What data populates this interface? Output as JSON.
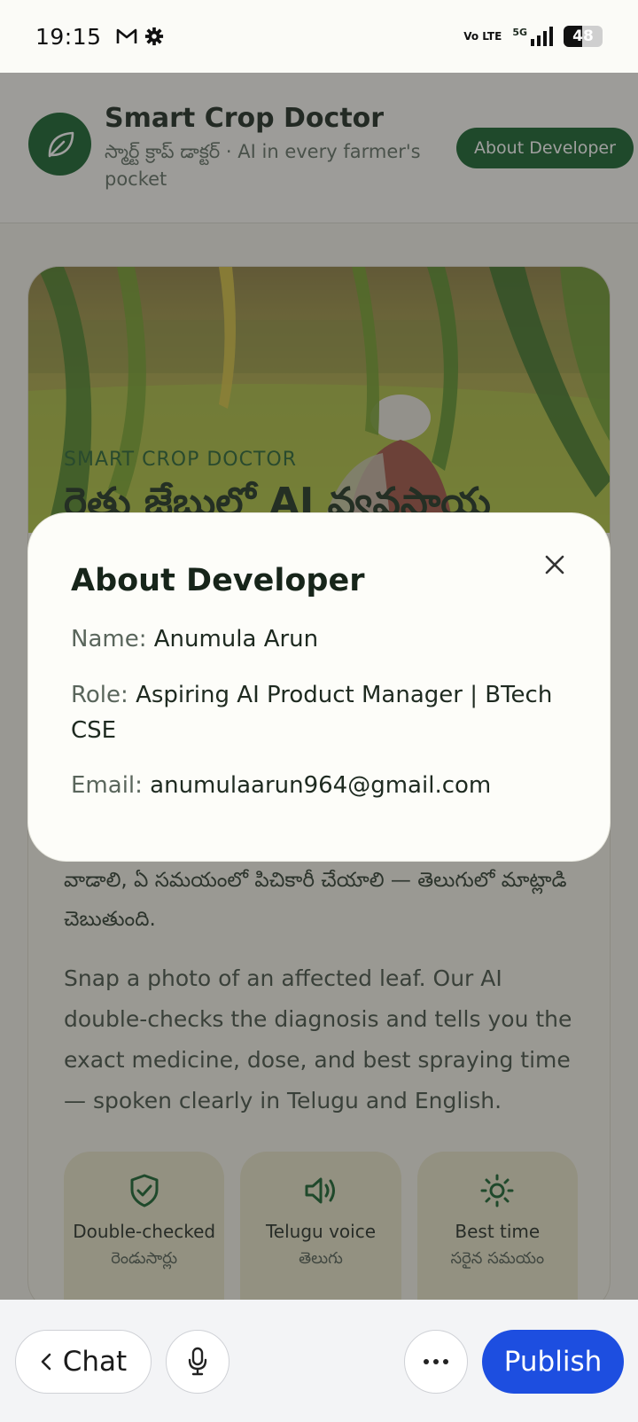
{
  "status_bar": {
    "time": "19:15",
    "icons": [
      "gmail-icon",
      "settings-icon"
    ],
    "network": "Vo LTE",
    "signal_label": "5G",
    "battery": "48",
    "battery_level": 0.48
  },
  "header": {
    "title": "Smart Crop Doctor",
    "subtitle": "స్మార్ట్ క్రాప్ డాక్టర్ · AI in every farmer's pocket",
    "about_button": "About Developer",
    "logo_icon": "leaf-icon",
    "brand_color": "#0b5a23"
  },
  "hero": {
    "eyebrow": "SMART CROP DOCTOR",
    "heading": "రైతు జేబులో AI వ్యవసాయ",
    "telugu_text": "వాడాలి, ఏ సమయంలో పిచికారీ చేయాలి — తెలుగులో మాట్లాడి చెబుతుంది.",
    "english_text": "Snap a photo of an affected leaf. Our AI double-checks the diagnosis and tells you the exact medicine, dose, and best spraying time — spoken clearly in Telugu and English.",
    "features": [
      {
        "icon": "shield-check-icon",
        "title": "Double-checked",
        "subtitle": "రెండుసార్లు"
      },
      {
        "icon": "speaker-icon",
        "title": "Telugu voice",
        "subtitle": "తెలుగు"
      },
      {
        "icon": "sun-icon",
        "title": "Best time",
        "subtitle": "సరైన సమయం"
      }
    ]
  },
  "modal": {
    "title": "About Developer",
    "name_label": "Name:",
    "name_value": "Anumula Arun",
    "role_label": "Role:",
    "role_value": "Aspiring AI Product Manager | BTech CSE",
    "email_label": "Email:",
    "email_value": "anumulaarun964@gmail.com",
    "close_icon": "close-icon"
  },
  "bottom_bar": {
    "chat_label": "Chat",
    "publish_label": "Publish",
    "publish_color": "#1d4ee0"
  }
}
